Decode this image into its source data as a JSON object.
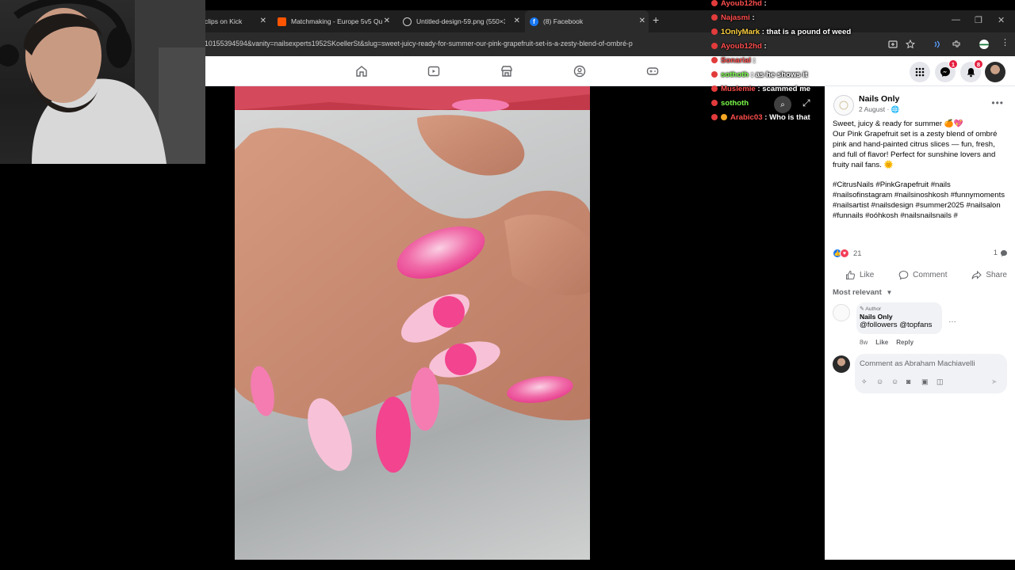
{
  "browser": {
    "tabs": [
      {
        "label": "clips on Kick",
        "active": false
      },
      {
        "label": "Matchmaking - Europe 5v5 Qu",
        "active": false
      },
      {
        "label": "Untitled-design-59.png (550×3",
        "active": false
      },
      {
        "label": "(8) Facebook",
        "active": true
      }
    ],
    "url": "10155394594&vanity=nailsexperts1952SKoellerSt&slug=sweet-juicy-ready-for-summer-our-pink-grapefruit-set-is-a-zesty-blend-of-ombré-p"
  },
  "facebook": {
    "nav": [
      "home-icon",
      "video-icon",
      "marketplace-icon",
      "groups-icon",
      "gaming-icon"
    ],
    "messenger_badge": "1",
    "notifications_badge": "8"
  },
  "post": {
    "page_name": "Nails Only",
    "date": "2 August · ",
    "caption_line1": "Sweet, juicy & ready for summer 🍊💖",
    "caption_body": "Our Pink Grapefruit set is a zesty blend of ombré pink and hand-painted citrus slices — fun, fresh, and full of flavor! Perfect for sunshine lovers and fruity nail fans. 🌞",
    "hashtags": "#CitrusNails #PinkGrapefruit #nails #nailsofinstagram #nailsinoshkosh #funnymoments #nailsartist #nailsdesign #summer2025 #nailsalon #funnails #oóhkosh #nailsnailsnails #",
    "reaction_count": "21",
    "comment_count": "1",
    "actions": {
      "like": "Like",
      "comment": "Comment",
      "share": "Share"
    },
    "sort_label": "Most relevant",
    "comment": {
      "author_badge": "Author",
      "name": "Nails Only",
      "text": "@followers @topfans",
      "age": "8w",
      "like": "Like",
      "reply": "Reply"
    },
    "comment_placeholder": "Comment as Abraham Machiavelli"
  },
  "chat": [
    {
      "user": "Ayoub12hd",
      "msg": "",
      "color": "#ff4d4d"
    },
    {
      "user": "Najasmi",
      "msg": "",
      "color": "#ff4d4d"
    },
    {
      "user": "1OnlyMark",
      "msg": "that is a pound of weed",
      "color": "#ffd23f"
    },
    {
      "user": "Ayoub12hd",
      "msg": "",
      "color": "#ff4d4d"
    },
    {
      "user": "Sonarial",
      "msg": "",
      "color": "#ff4d4d"
    },
    {
      "user": "sothoth",
      "msg": "as he shows it",
      "color": "#7cfc4a"
    },
    {
      "user": "Muslemie",
      "msg": "scammed me",
      "color": "#ff4d4d"
    },
    {
      "user": "sothoth",
      "msg": "",
      "color": "#7cfc4a"
    },
    {
      "user": "Arabic03",
      "msg": "Who is that",
      "color": "#ff4d4d"
    }
  ],
  "colors": {
    "fb_blue": "#1877f2",
    "fb_grey": "#65676b",
    "chat_bg": "transparent"
  }
}
